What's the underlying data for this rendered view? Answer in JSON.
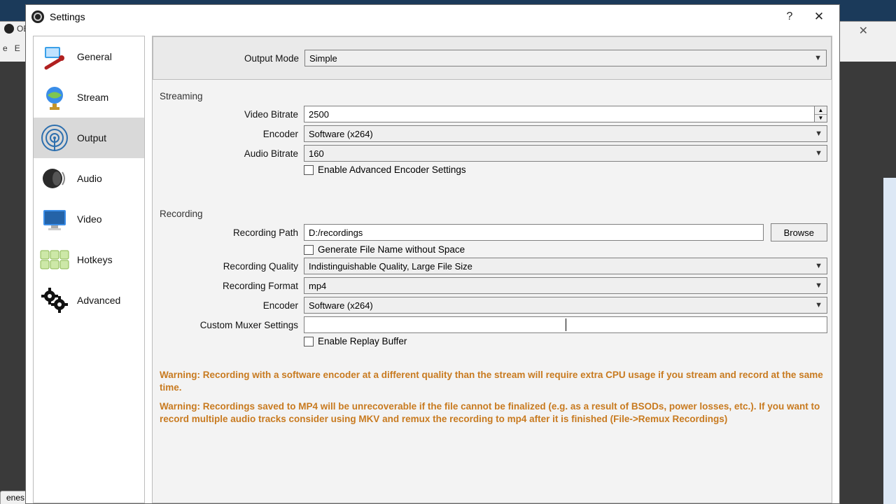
{
  "bg": {
    "app_short": "OBS",
    "menu_letters": [
      "e",
      "E"
    ],
    "tab": "enes"
  },
  "dialog": {
    "title": "Settings"
  },
  "sidebar": {
    "items": [
      {
        "label": "General"
      },
      {
        "label": "Stream"
      },
      {
        "label": "Output"
      },
      {
        "label": "Audio"
      },
      {
        "label": "Video"
      },
      {
        "label": "Hotkeys"
      },
      {
        "label": "Advanced"
      }
    ]
  },
  "output_mode": {
    "label": "Output Mode",
    "value": "Simple"
  },
  "streaming": {
    "header": "Streaming",
    "video_bitrate": {
      "label": "Video Bitrate",
      "value": "2500"
    },
    "encoder": {
      "label": "Encoder",
      "value": "Software (x264)"
    },
    "audio_bitrate": {
      "label": "Audio Bitrate",
      "value": "160"
    },
    "adv_encoder": {
      "label": "Enable Advanced Encoder Settings"
    }
  },
  "recording": {
    "header": "Recording",
    "path": {
      "label": "Recording Path",
      "value": "D:/recordings",
      "browse": "Browse"
    },
    "gen_name": {
      "label": "Generate File Name without Space"
    },
    "quality": {
      "label": "Recording Quality",
      "value": "Indistinguishable Quality, Large File Size"
    },
    "format": {
      "label": "Recording Format",
      "value": "mp4"
    },
    "encoder": {
      "label": "Encoder",
      "value": "Software (x264)"
    },
    "muxer": {
      "label": "Custom Muxer Settings",
      "value": ""
    },
    "replay": {
      "label": "Enable Replay Buffer"
    }
  },
  "warnings": {
    "w1": "Warning: Recording with a software encoder at a different quality than the stream will require extra CPU usage if you stream and record at the same time.",
    "w2": "Warning: Recordings saved to MP4 will be unrecoverable if the file cannot be finalized (e.g. as a result of BSODs, power losses, etc.). If you want to record multiple audio tracks consider using MKV and remux the recording to mp4 after it is finished (File->Remux Recordings)"
  }
}
